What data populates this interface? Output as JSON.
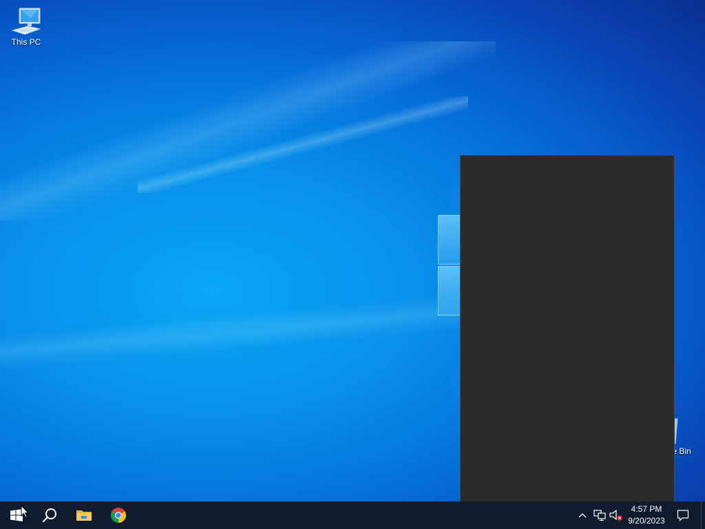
{
  "desktop": {
    "icons": [
      {
        "label": "This PC",
        "icon": "computer-icon"
      },
      {
        "label": "Recycle Bin",
        "icon": "recycle-bin-icon"
      }
    ],
    "colors": {
      "wallpaper_center": "#0aa8f4",
      "wallpaper_edge": "#0b2f92",
      "flyout_bg": "#2b2b2b",
      "taskbar_bg": "#0e1c2d"
    }
  },
  "taskbar": {
    "start": {
      "icon": "windows-start-icon"
    },
    "search": {
      "icon": "search-icon"
    },
    "pinned": [
      {
        "name": "File Explorer",
        "icon": "folder-icon"
      },
      {
        "name": "Google Chrome",
        "icon": "chrome-icon"
      }
    ],
    "tray": {
      "overflow_icon": "chevron-up-icon",
      "network_icon": "network-icon",
      "volume_icon": "volume-muted-icon",
      "time": "4:57 PM",
      "date": "9/20/2023",
      "notification_icon": "action-center-icon"
    }
  }
}
